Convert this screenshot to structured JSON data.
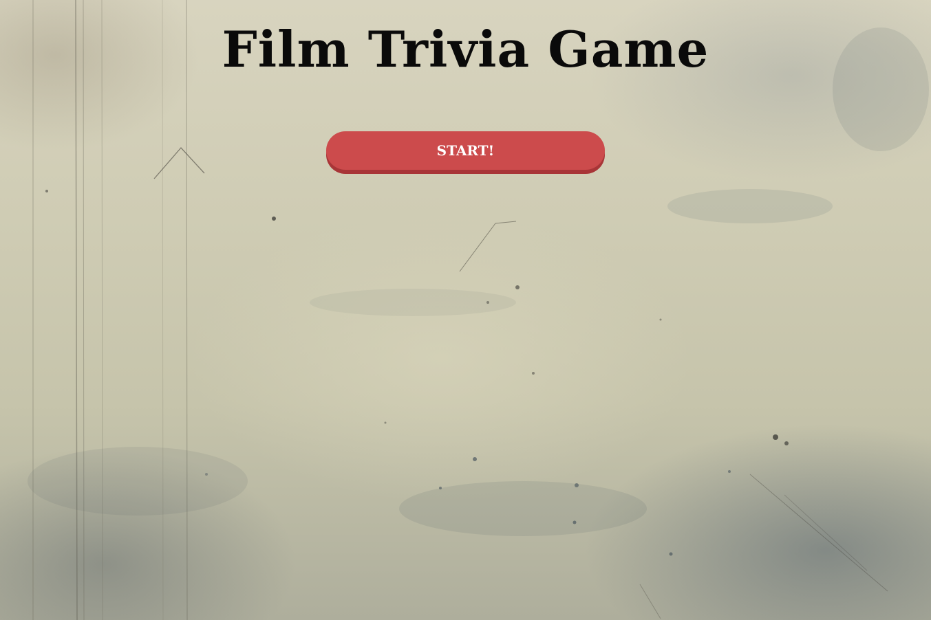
{
  "game": {
    "title": "Film Trivia Game",
    "start_label": "START!"
  },
  "colors": {
    "button": "#cc4b4c",
    "button_shadow": "#a83537",
    "title": "#0a0a0a",
    "paper": "#d8d4bf"
  }
}
